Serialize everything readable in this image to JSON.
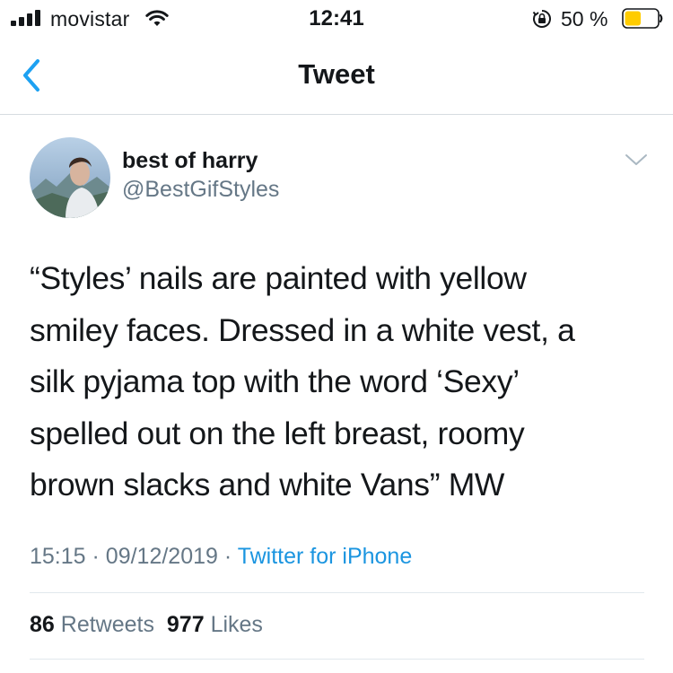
{
  "status_bar": {
    "carrier": "movistar",
    "time": "12:41",
    "battery_percent": "50 %",
    "battery_level": 0.5,
    "battery_color": "#ffcc00"
  },
  "nav": {
    "title": "Tweet",
    "back_icon": "chevron-left-icon",
    "accent_color": "#1da1f2"
  },
  "tweet": {
    "author": {
      "display_name": "best of harry",
      "handle": "@BestGifStyles"
    },
    "text_lines": [
      "“Styles’ nails are painted with yellow",
      "smiley faces. Dressed in a white vest, a",
      "silk pyjama top with the word ‘Sexy’",
      "spelled out on the left breast, roomy",
      "brown slacks and white Vans” MW"
    ],
    "time": "15:15",
    "date": "09/12/2019",
    "separator": "·",
    "source": "Twitter for iPhone",
    "retweets_count": "86",
    "retweets_label": "Retweets",
    "likes_count": "977",
    "likes_label": "Likes"
  }
}
